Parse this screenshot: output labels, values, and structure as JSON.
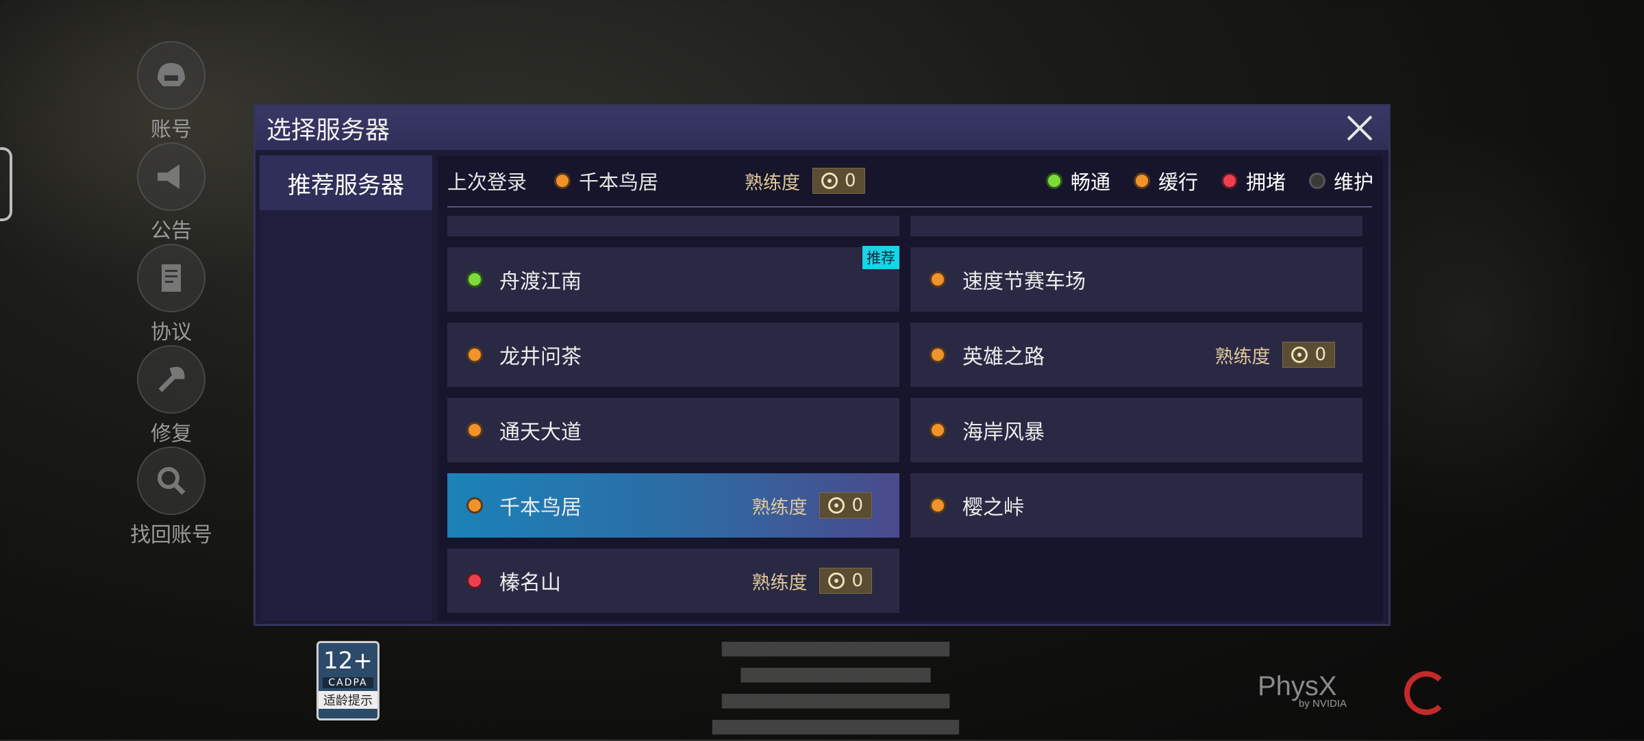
{
  "side_menu": [
    {
      "label": "账号",
      "icon": "helmet-icon"
    },
    {
      "label": "公告",
      "icon": "megaphone-icon"
    },
    {
      "label": "协议",
      "icon": "document-icon"
    },
    {
      "label": "修复",
      "icon": "wrench-icon"
    },
    {
      "label": "找回账号",
      "icon": "magnifier-icon"
    }
  ],
  "dialog": {
    "title": "选择服务器",
    "sidebar_tab": "推荐服务器",
    "last_login_label": "上次登录",
    "last_login_server": "千本鸟居",
    "proficiency_label": "熟练度",
    "proficiency_value": "0",
    "legend": [
      {
        "label": "畅通",
        "status": "green"
      },
      {
        "label": "缓行",
        "status": "orange"
      },
      {
        "label": "拥堵",
        "status": "red"
      },
      {
        "label": "维护",
        "status": "gray"
      }
    ],
    "recommend_tag": "推荐",
    "servers": [
      {
        "name": "舟渡江南",
        "status": "green",
        "recommended": true
      },
      {
        "name": "速度节赛车场",
        "status": "orange"
      },
      {
        "name": "龙井问茶",
        "status": "orange"
      },
      {
        "name": "英雄之路",
        "status": "orange",
        "proficiency": "0"
      },
      {
        "name": "通天大道",
        "status": "orange"
      },
      {
        "name": "海岸风暴",
        "status": "orange"
      },
      {
        "name": "千本鸟居",
        "status": "orange",
        "proficiency": "0",
        "selected": true
      },
      {
        "name": "樱之峠",
        "status": "orange"
      },
      {
        "name": "榛名山",
        "status": "red",
        "proficiency": "0"
      }
    ]
  },
  "footer": {
    "age_rating": "12+",
    "age_org": "CADPA",
    "age_tip": "适龄提示",
    "physx": "PhysX",
    "nvidia": "by NVIDIA"
  },
  "colors": {
    "green": "#7ddc3b",
    "orange": "#f0932b",
    "red": "#ee3f4f",
    "gray": "#3a3a3a",
    "selected": "#1b82b8",
    "tag": "#19d3e6"
  }
}
